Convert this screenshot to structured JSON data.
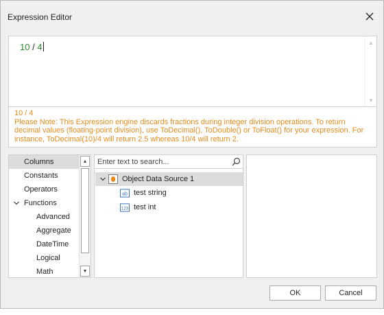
{
  "window": {
    "title": "Expression Editor"
  },
  "editor": {
    "left_operand": "10",
    "operator": "/",
    "right_operand": "4"
  },
  "info": {
    "expression": "10 / 4",
    "note": "Please Note:  This Expression engine discards fractions during integer division operations. To return decimal values (floating-point division), use ToDecimal(), ToDouble() or ToFloat() for your expression. For instance, ToDecimal(10)/4 will return 2.5 whereas 10/4 will return 2.",
    "color": "#e68a1c"
  },
  "categories": {
    "items": [
      {
        "label": "Columns",
        "selected": true
      },
      {
        "label": "Constants"
      },
      {
        "label": "Operators"
      },
      {
        "label": "Functions",
        "expanded": true
      },
      {
        "label": "Advanced"
      },
      {
        "label": "Aggregate"
      },
      {
        "label": "DateTime"
      },
      {
        "label": "Logical"
      },
      {
        "label": "Math"
      }
    ]
  },
  "tree": {
    "search_placeholder": "Enter text to search...",
    "root": {
      "label": "Object Data Source 1",
      "icon": "data-source-icon"
    },
    "children": [
      {
        "label": "test string",
        "icon": "string-field-icon",
        "icon_text": "ab"
      },
      {
        "label": "test int",
        "icon": "int-field-icon",
        "icon_text": "123"
      }
    ]
  },
  "buttons": {
    "ok": "OK",
    "cancel": "Cancel"
  },
  "colors": {
    "selection": "#dcdcdc",
    "number": "#2c8a2c",
    "datasource": "#e8891b",
    "field_icon": "#2f6db5"
  }
}
